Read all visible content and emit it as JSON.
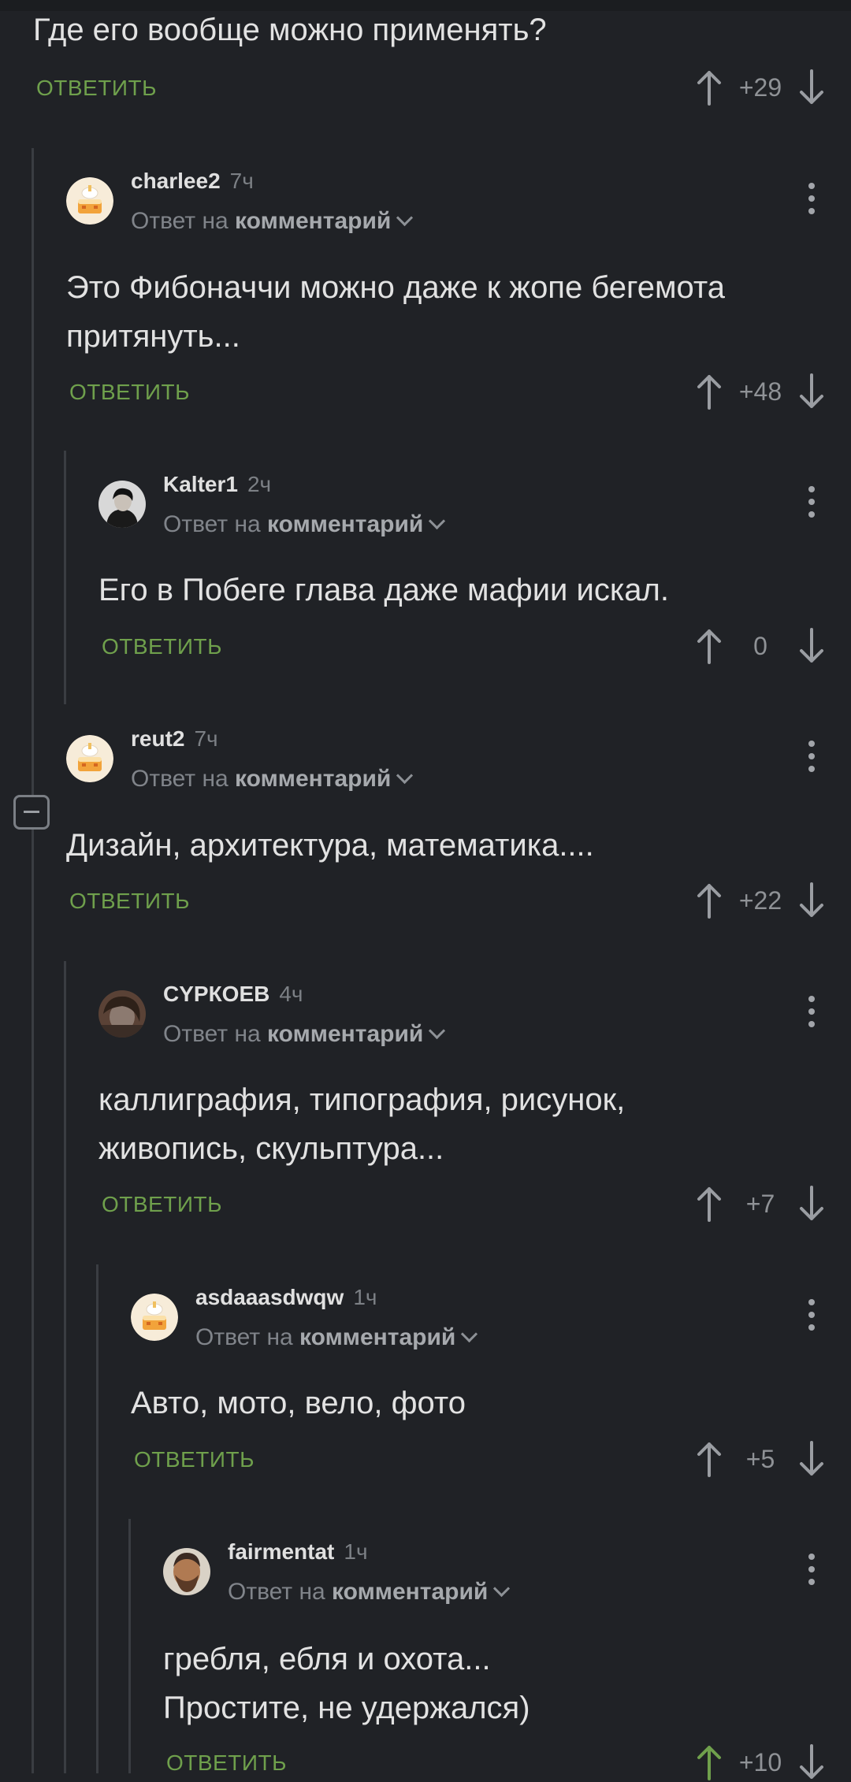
{
  "top_comment": {
    "text": "Где его вообще можно применять?",
    "reply_label": "ОТВЕТИТЬ",
    "score": "+29"
  },
  "reply_to_prefix": "Ответ на",
  "reply_to_target": "комментарий",
  "colors": {
    "background": "#202226",
    "reply_green": "#6fa04c",
    "upvote_green": "#6fa04c",
    "thread_line": "#3a3d42"
  },
  "comments": [
    {
      "author": "charlee2",
      "time": "7ч",
      "text": "Это Фибоначчи можно даже к жопе бегемота притянуть...",
      "reply_label": "ОТВЕТИТЬ",
      "score": "+48",
      "avatar": "cake-avatar-icon"
    },
    {
      "author": "Kalter1",
      "time": "2ч",
      "text": "Его в Побеге глава даже мафии искал.",
      "reply_label": "ОТВЕТИТЬ",
      "score": "0",
      "avatar": "dark-portrait-avatar"
    },
    {
      "author": "reut2",
      "time": "7ч",
      "text": "Дизайн, архитектура, математика....",
      "reply_label": "ОТВЕТИТЬ",
      "score": "+22",
      "avatar": "cake-avatar-icon"
    },
    {
      "author": "СYРКОЕВ",
      "time": "4ч",
      "text": "каллиграфия, типография, рисунок, живопись, скульптура...",
      "reply_label": "ОТВЕТИТЬ",
      "score": "+7",
      "avatar": "photo-avatar"
    },
    {
      "author": "asdaaasdwqw",
      "time": "1ч",
      "text": "Авто, мото, вело, фото",
      "reply_label": "ОТВЕТИТЬ",
      "score": "+5",
      "avatar": "cake-avatar-icon"
    },
    {
      "author": "fairmentat",
      "time": "1ч",
      "text_line1": "гребля, ебля и охота...",
      "text_line2": "Простите, не удержался)",
      "reply_label": "ОТВЕТИТЬ",
      "score": "+10",
      "avatar": "bearded-man-avatar",
      "upvoted": true
    }
  ]
}
